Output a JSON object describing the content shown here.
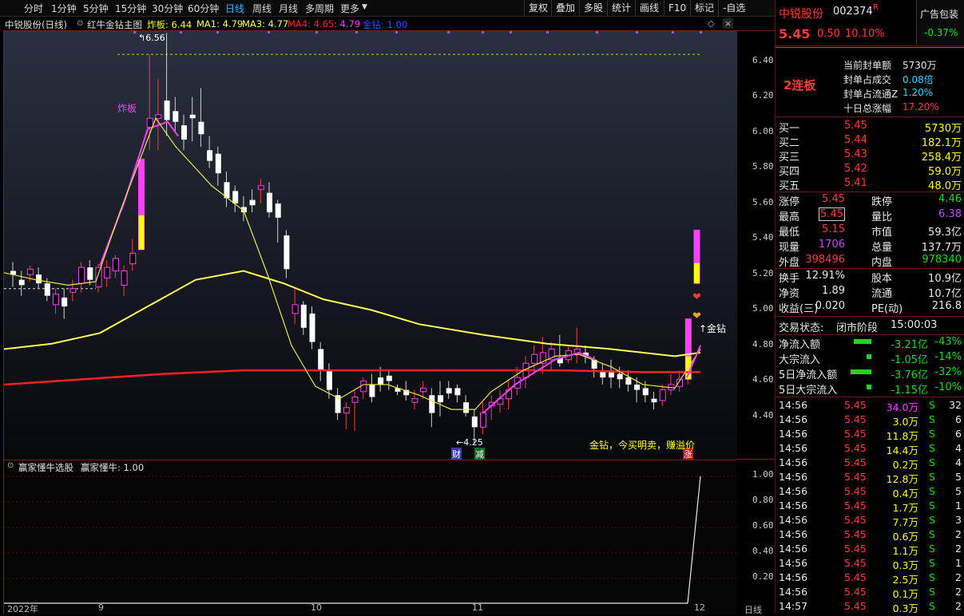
{
  "toolbar": {
    "timeframes": [
      "分时",
      "1分钟",
      "5分钟",
      "15分钟",
      "30分钟",
      "60分钟",
      "日线",
      "周线",
      "月线",
      "多周期",
      "更多"
    ],
    "active_timeframe": "日线",
    "buttons": [
      "复权",
      "叠加",
      "多股",
      "统计",
      "画线",
      "F10",
      "标记",
      "-自选"
    ]
  },
  "info": {
    "stock_title": "中锐股份(日线)",
    "indicator_name": "红牛金钻主图",
    "zhaban_label": "炸板: 6.44",
    "ma1": "MA1: 4.79",
    "ma3": "MA3: 4.77",
    "ma4": "MA4: 4.65",
    "extra": ": 4.79",
    "jinzuan": "金钻: 1.00"
  },
  "main_axis": [
    "6.40",
    "6.20",
    "6.00",
    "5.80",
    "5.60",
    "5.40",
    "5.20",
    "5.00",
    "4.80",
    "4.60",
    "4.40"
  ],
  "sub_axis": [
    "1.00",
    "0.80",
    "0.60",
    "0.40",
    "0.20"
  ],
  "annotations": {
    "high_label": "6.56",
    "low_label": "4.25",
    "zhaban_tag": "炸板",
    "cai_tag": "财",
    "jian_tag": "减",
    "zhang_tag": "涨",
    "jinzuan_tag": "↑金钻",
    "slogan": "金钻，今买明卖，赚溢价"
  },
  "sub_info": {
    "name": "赢家懂牛选股",
    "value": "赢家懂牛: 1.00"
  },
  "bottom_axis": [
    "2022年",
    "9",
    "10",
    "11",
    "12",
    "日线"
  ],
  "quote": {
    "name": "中锐股份",
    "code": "002374",
    "flag": "R",
    "ad_label": "广告包装",
    "ad_change": "-0.37%",
    "price": "5.45",
    "change": "0.50",
    "pct": "10.10%",
    "board_tag": "2连板",
    "seal": [
      {
        "label": "当前封单额",
        "value": "5730万"
      },
      {
        "label": "封单占成交",
        "value": "0.08倍"
      },
      {
        "label": "封单占流通Z",
        "value": "1.20%"
      },
      {
        "label": "十日总涨幅",
        "value": "17.20%"
      }
    ],
    "book": [
      {
        "label": "买一",
        "price": "5.45",
        "vol": "5730万"
      },
      {
        "label": "买二",
        "price": "5.44",
        "vol": "182.1万"
      },
      {
        "label": "买三",
        "price": "5.43",
        "vol": "258.4万"
      },
      {
        "label": "买四",
        "price": "5.42",
        "vol": "59.0万"
      },
      {
        "label": "买五",
        "price": "5.41",
        "vol": "48.0万"
      }
    ],
    "stats": [
      {
        "l1": "涨停",
        "v1": "5.45",
        "l2": "跌停",
        "v2": "4.46"
      },
      {
        "l1": "最高",
        "v1": "5.45",
        "l2": "量比",
        "v2": "6.38"
      },
      {
        "l1": "最低",
        "v1": "5.15",
        "l2": "市值",
        "v2": "59.3亿"
      },
      {
        "l1": "现量",
        "v1": "1706",
        "l2": "总量",
        "v2": "137.7万"
      },
      {
        "l1": "外盘",
        "v1": "398496",
        "l2": "内盘",
        "v2": "978340"
      }
    ],
    "fund": [
      {
        "l1": "换手",
        "v1": "12.91%",
        "l2": "股本",
        "v2": "10.9亿"
      },
      {
        "l1": "净资",
        "v1": "1.89",
        "l2": "流通",
        "v2": "10.7亿"
      },
      {
        "l1": "收益(三)",
        "v1": "0.020",
        "l2": "PE(动)",
        "v2": "216.8"
      }
    ],
    "status": {
      "label": "交易状态:",
      "value": "闭市阶段",
      "time": "15:00:03"
    },
    "flows": [
      {
        "label": "净流入额",
        "value": "-3.21亿",
        "pct": "-43%"
      },
      {
        "label": "大宗流入",
        "value": "-1.05亿",
        "pct": "-14%"
      },
      {
        "label": "5日净流入额",
        "value": "-3.76亿",
        "pct": "-32%"
      },
      {
        "label": "5日大宗流入",
        "value": "-1.15亿",
        "pct": "-10%"
      }
    ],
    "trades": [
      {
        "t": "14:56",
        "p": "5.45",
        "v": "34.0万",
        "s": "S",
        "n": "32"
      },
      {
        "t": "14:56",
        "p": "5.45",
        "v": "3.0万",
        "s": "S",
        "n": "6"
      },
      {
        "t": "14:56",
        "p": "5.45",
        "v": "11.8万",
        "s": "S",
        "n": "6"
      },
      {
        "t": "14:56",
        "p": "5.45",
        "v": "14.4万",
        "s": "S",
        "n": "4"
      },
      {
        "t": "14:56",
        "p": "5.45",
        "v": "0.2万",
        "s": "S",
        "n": "4"
      },
      {
        "t": "14:56",
        "p": "5.45",
        "v": "12.8万",
        "s": "S",
        "n": "5"
      },
      {
        "t": "14:56",
        "p": "5.45",
        "v": "0.4万",
        "s": "S",
        "n": "5"
      },
      {
        "t": "14:56",
        "p": "5.45",
        "v": "1.7万",
        "s": "S",
        "n": "1"
      },
      {
        "t": "14:56",
        "p": "5.45",
        "v": "7.7万",
        "s": "S",
        "n": "3"
      },
      {
        "t": "14:56",
        "p": "5.45",
        "v": "0.6万",
        "s": "S",
        "n": "2"
      },
      {
        "t": "14:56",
        "p": "5.45",
        "v": "1.1万",
        "s": "S",
        "n": "2"
      },
      {
        "t": "14:56",
        "p": "5.45",
        "v": "0.3万",
        "s": "S",
        "n": "1"
      },
      {
        "t": "14:56",
        "p": "5.45",
        "v": "2.5万",
        "s": "S",
        "n": "2"
      },
      {
        "t": "14:56",
        "p": "5.45",
        "v": "0.1万",
        "s": "S",
        "n": "2"
      },
      {
        "t": "14:57",
        "p": "5.45",
        "v": "0.3万",
        "s": "S",
        "n": "2"
      }
    ]
  },
  "colors": {
    "up": "#ff3b3b",
    "down": "#21d421",
    "ma_yellow": "#ffff55",
    "ma_red": "#ff2020",
    "ma_magenta": "#ff40ff",
    "bg": "#000000"
  }
}
